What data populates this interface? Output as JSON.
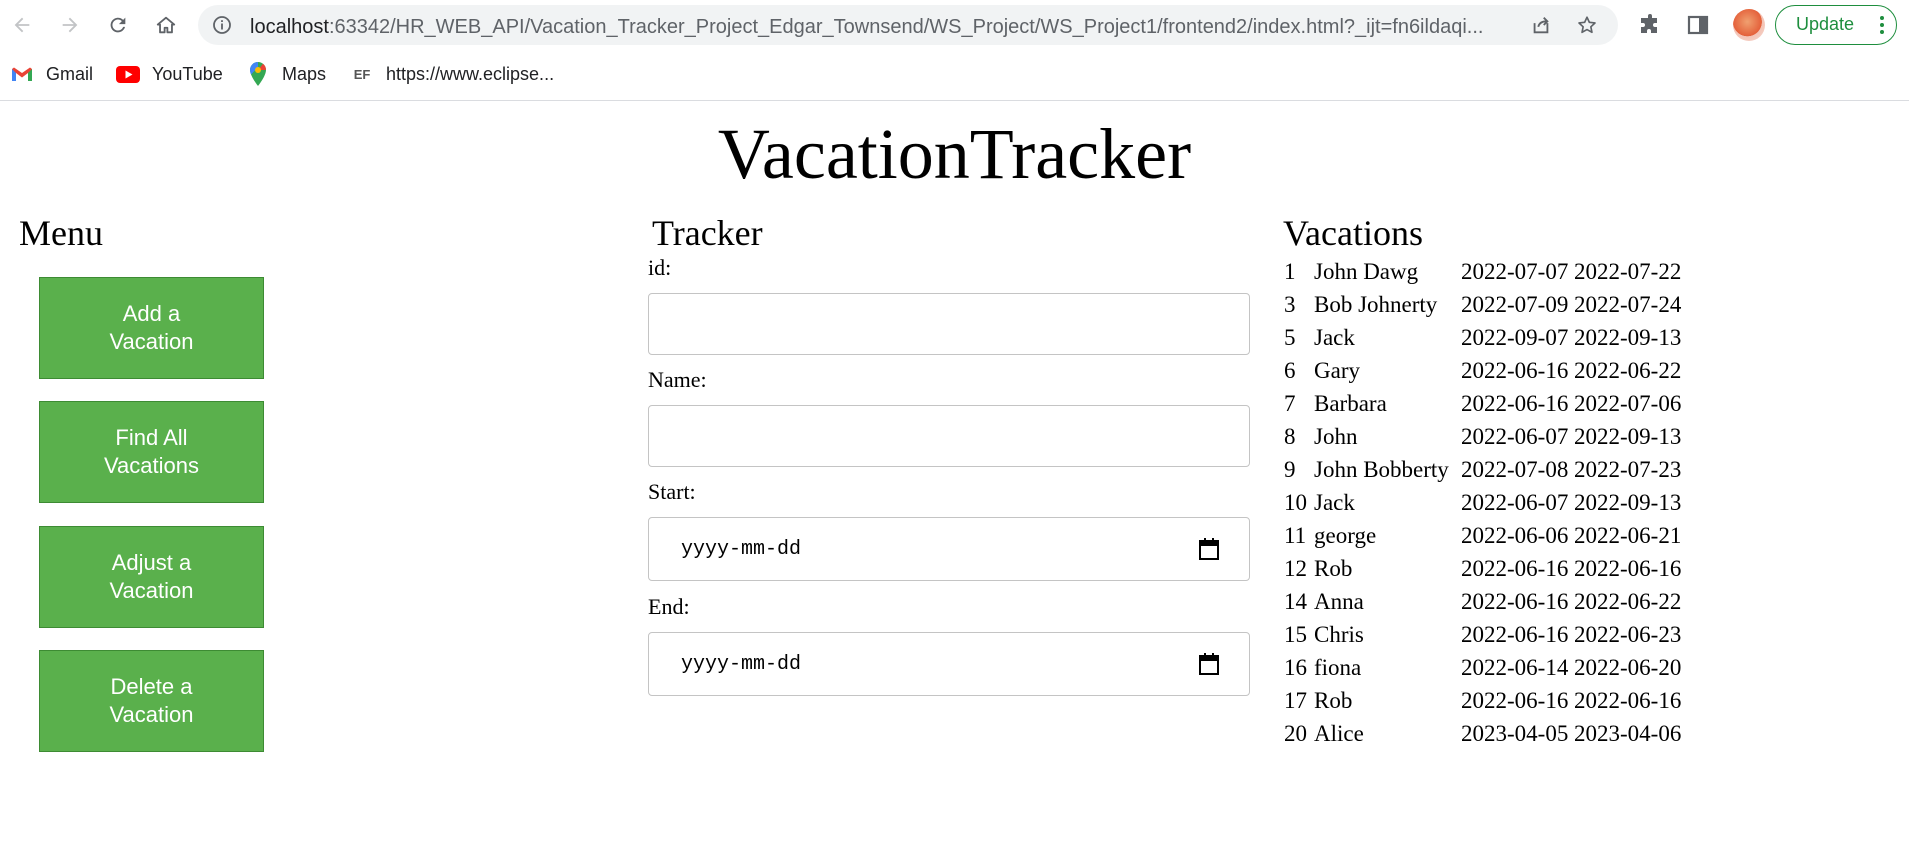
{
  "browser": {
    "url_host": "localhost",
    "url_rest": ":63342/HR_WEB_API/Vacation_Tracker_Project_Edgar_Townsend/WS_Project/WS_Project1/frontend2/index.html?_ijt=fn6ildaqi...",
    "update_label": "Update"
  },
  "bookmarks": [
    {
      "label": "Gmail",
      "icon": "gmail-icon"
    },
    {
      "label": "YouTube",
      "icon": "youtube-icon"
    },
    {
      "label": "Maps",
      "icon": "maps-icon"
    },
    {
      "label": "https://www.eclipse...",
      "icon": "eclipse-icon"
    }
  ],
  "page": {
    "title": "VacationTracker"
  },
  "menu": {
    "heading": "Menu",
    "buttons": [
      {
        "line1": "Add a",
        "line2": "Vacation"
      },
      {
        "line1": "Find All",
        "line2": "Vacations"
      },
      {
        "line1": "Adjust a",
        "line2": "Vacation"
      },
      {
        "line1": "Delete a",
        "line2": "Vacation"
      }
    ]
  },
  "tracker": {
    "heading": "Tracker",
    "id_label": "id:",
    "name_label": "Name:",
    "start_label": "Start:",
    "end_label": "End:",
    "start_placeholder": "yyyy-mm-dd",
    "end_placeholder": "yyyy-mm-dd"
  },
  "vacations": {
    "heading": "Vacations",
    "rows": [
      {
        "id": "1",
        "name": "John Dawg",
        "start": "2022-07-07",
        "end": "2022-07-22"
      },
      {
        "id": "3",
        "name": "Bob Johnerty",
        "start": "2022-07-09",
        "end": "2022-07-24"
      },
      {
        "id": "5",
        "name": "Jack",
        "start": "2022-09-07",
        "end": "2022-09-13"
      },
      {
        "id": "6",
        "name": "Gary",
        "start": "2022-06-16",
        "end": "2022-06-22"
      },
      {
        "id": "7",
        "name": "Barbara",
        "start": "2022-06-16",
        "end": "2022-07-06"
      },
      {
        "id": "8",
        "name": "John",
        "start": "2022-06-07",
        "end": "2022-09-13"
      },
      {
        "id": "9",
        "name": "John Bobberty",
        "start": "2022-07-08",
        "end": "2022-07-23"
      },
      {
        "id": "10",
        "name": "Jack",
        "start": "2022-06-07",
        "end": "2022-09-13"
      },
      {
        "id": "11",
        "name": "george",
        "start": "2022-06-06",
        "end": "2022-06-21"
      },
      {
        "id": "12",
        "name": "Rob",
        "start": "2022-06-16",
        "end": "2022-06-16"
      },
      {
        "id": "14",
        "name": "Anna",
        "start": "2022-06-16",
        "end": "2022-06-22"
      },
      {
        "id": "15",
        "name": "Chris",
        "start": "2022-06-16",
        "end": "2022-06-23"
      },
      {
        "id": "16",
        "name": "fiona",
        "start": "2022-06-14",
        "end": "2022-06-20"
      },
      {
        "id": "17",
        "name": "Rob",
        "start": "2022-06-16",
        "end": "2022-06-16"
      },
      {
        "id": "20",
        "name": "Alice",
        "start": "2023-04-05",
        "end": "2023-04-06"
      }
    ]
  }
}
